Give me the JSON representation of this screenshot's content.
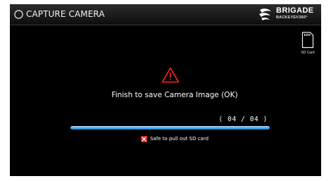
{
  "header": {
    "title": "CAPTURE CAMERA",
    "back_icon": "back-circle-icon",
    "brand": {
      "name": "BRIGADE",
      "subtitle": "BACKEYE®360°",
      "icon": "brigade-logo-icon"
    }
  },
  "sd_card": {
    "label": "SD Card",
    "icon": "sd-card-icon"
  },
  "status": {
    "icon": "warning-triangle-icon",
    "message": "Finish to save Camera Image (OK)",
    "counter": "( 04 / 04 )",
    "progress": {
      "completed": 4,
      "total": 4,
      "fraction": 1.0
    }
  },
  "notice": {
    "icon": "red-x-icon",
    "text": "Safe to pull out SD card"
  },
  "colors": {
    "background": "#000000",
    "titlebar": "#1b1b1b",
    "text": "#ffffff",
    "warning": "#e0201d",
    "progress": "#4fb0f0",
    "notice_icon": "#e0201d"
  }
}
